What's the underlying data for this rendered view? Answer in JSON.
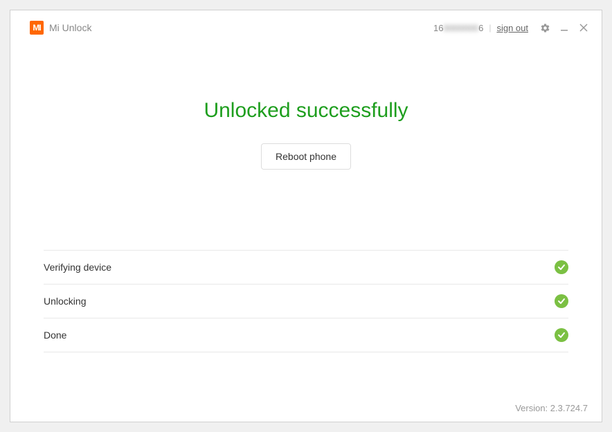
{
  "titlebar": {
    "app_title": "Mi Unlock",
    "user_id_prefix": "16",
    "user_id_hidden": "0000000",
    "user_id_suffix": "6",
    "sign_out": "sign out"
  },
  "main": {
    "headline": "Unlocked successfully",
    "reboot_button": "Reboot phone"
  },
  "steps": [
    {
      "label": "Verifying device",
      "status": "done"
    },
    {
      "label": "Unlocking",
      "status": "done"
    },
    {
      "label": "Done",
      "status": "done"
    }
  ],
  "footer": {
    "version": "Version: 2.3.724.7"
  }
}
